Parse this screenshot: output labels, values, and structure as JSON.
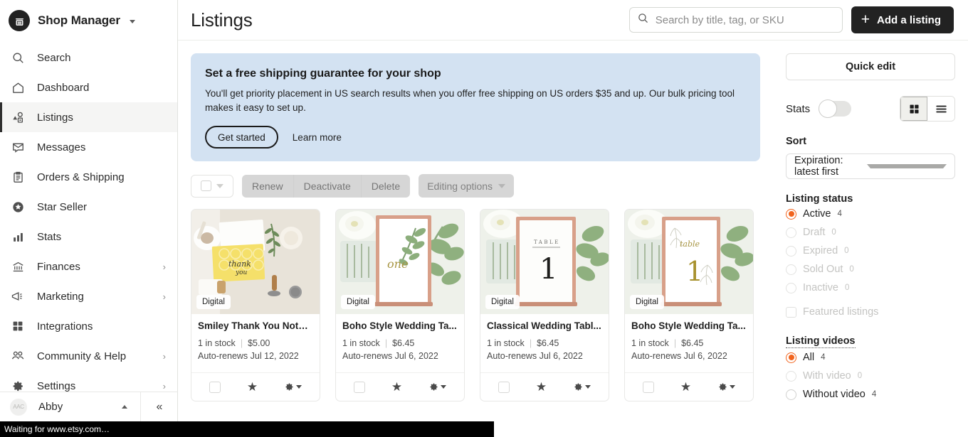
{
  "sidebar": {
    "brand": {
      "name": "Shop Manager",
      "logo_icon": "etsy-shop-icon",
      "caret_icon": "chevron-down-icon"
    },
    "items": [
      {
        "label": "Search",
        "icon": "search-icon",
        "has_chevron": false,
        "active": false
      },
      {
        "label": "Dashboard",
        "icon": "home-icon",
        "has_chevron": false,
        "active": false
      },
      {
        "label": "Listings",
        "icon": "shapes-icon",
        "has_chevron": false,
        "active": true
      },
      {
        "label": "Messages",
        "icon": "envelope-icon",
        "has_chevron": false,
        "active": false
      },
      {
        "label": "Orders & Shipping",
        "icon": "clipboard-icon",
        "has_chevron": false,
        "active": false
      },
      {
        "label": "Star Seller",
        "icon": "star-badge-icon",
        "has_chevron": false,
        "active": false
      },
      {
        "label": "Stats",
        "icon": "bar-chart-icon",
        "has_chevron": false,
        "active": false
      },
      {
        "label": "Finances",
        "icon": "bank-icon",
        "has_chevron": true,
        "active": false
      },
      {
        "label": "Marketing",
        "icon": "megaphone-icon",
        "has_chevron": true,
        "active": false
      },
      {
        "label": "Integrations",
        "icon": "grid-squares-icon",
        "has_chevron": false,
        "active": false
      },
      {
        "label": "Community & Help",
        "icon": "people-icon",
        "has_chevron": true,
        "active": false
      },
      {
        "label": "Settings",
        "icon": "gear-icon",
        "has_chevron": true,
        "active": false
      }
    ],
    "chevron_glyph": "›",
    "user": {
      "name": "Abby",
      "avatar_initials": "AAC",
      "caret_icon": "chevron-up-icon"
    },
    "collapse_icon": "double-chevron-left-icon",
    "collapse_glyph": "«"
  },
  "header": {
    "title": "Listings",
    "search": {
      "placeholder": "Search by title, tag, or SKU",
      "value": "",
      "icon": "search-icon"
    },
    "add_listing": {
      "label": "Add a listing",
      "icon": "plus-icon",
      "plus_glyph": "+"
    }
  },
  "banner": {
    "title": "Set a free shipping guarantee for your shop",
    "text": "You'll get priority placement in US search results when you offer free shipping on US orders $35 and up. Our bulk pricing tool makes it easy to set up.",
    "primary_label": "Get started",
    "secondary_label": "Learn more",
    "background_color": "#d3e2f2"
  },
  "toolbar": {
    "select_all_icon": "checkbox-icon",
    "select_all_caret_icon": "chevron-down-icon",
    "buttons": [
      "Renew",
      "Deactivate",
      "Delete"
    ],
    "editing_options_label": "Editing options",
    "editing_options_caret_icon": "chevron-down-icon"
  },
  "listings": [
    {
      "title": "Smiley Thank You Note ...",
      "badge": "Digital",
      "stock": "1 in stock",
      "price": "$5.00",
      "renews": "Auto-renews Jul 12, 2022",
      "image": "thank-you-note-card-photo"
    },
    {
      "title": "Boho Style Wedding Ta...",
      "badge": "Digital",
      "stock": "1 in stock",
      "price": "$6.45",
      "renews": "Auto-renews Jul 6, 2022",
      "image": "boho-wedding-table-number-one-photo"
    },
    {
      "title": "Classical Wedding Tabl...",
      "badge": "Digital",
      "stock": "1 in stock",
      "price": "$6.45",
      "renews": "Auto-renews Jul 6, 2022",
      "image": "classical-wedding-table-number-1-photo"
    },
    {
      "title": "Boho Style Wedding Ta...",
      "badge": "Digital",
      "stock": "1 in stock",
      "price": "$6.45",
      "renews": "Auto-renews Jul 6, 2022",
      "image": "boho-wedding-table-number-1-gold-photo"
    }
  ],
  "card_footer": {
    "checkbox_icon": "checkbox-icon",
    "star_icon": "star-icon",
    "star_glyph": "★",
    "gear_icon": "gear-icon",
    "gear_caret_icon": "chevron-down-icon"
  },
  "right_panel": {
    "quick_edit_label": "Quick edit",
    "stats_label": "Stats",
    "stats_enabled": false,
    "view_mode": "grid",
    "view_grid_icon": "grid-view-icon",
    "view_list_icon": "list-view-icon",
    "sort_label": "Sort",
    "sort_value": "Expiration: latest first",
    "sort_caret_icon": "chevron-down-icon",
    "listing_status": {
      "heading": "Listing status",
      "options": [
        {
          "label": "Active",
          "count": "4",
          "selected": true,
          "dimmed": false
        },
        {
          "label": "Draft",
          "count": "0",
          "selected": false,
          "dimmed": true
        },
        {
          "label": "Expired",
          "count": "0",
          "selected": false,
          "dimmed": true
        },
        {
          "label": "Sold Out",
          "count": "0",
          "selected": false,
          "dimmed": true
        },
        {
          "label": "Inactive",
          "count": "0",
          "selected": false,
          "dimmed": true
        }
      ],
      "featured_label": "Featured listings",
      "featured_checked": false
    },
    "listing_videos": {
      "heading": "Listing videos",
      "options": [
        {
          "label": "All",
          "count": "4",
          "selected": true,
          "dimmed": false
        },
        {
          "label": "With video",
          "count": "0",
          "selected": false,
          "dimmed": true
        },
        {
          "label": "Without video",
          "count": "4",
          "selected": false,
          "dimmed": false
        }
      ]
    },
    "accent_color": "#f1641e"
  },
  "status_bar": {
    "text": "Waiting for www.etsy.com…"
  }
}
